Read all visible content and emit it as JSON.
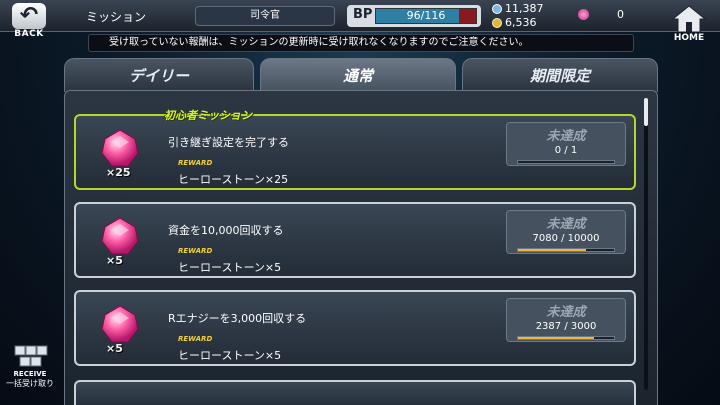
{
  "header": {
    "back_label": "BACK",
    "title": "ミッション",
    "rank": "司令官",
    "bp_label": "BP",
    "bp_value": "96/116",
    "bp_fraction": 0.83,
    "currency_silver": "11,387",
    "currency_gold": "6,536",
    "gems": "0",
    "home_label": "HOME"
  },
  "notice": "受け取っていない報酬は、ミッションの更新時に受け取れなくなりますのでご注意ください。",
  "tabs": [
    {
      "label": "デイリー",
      "active": false
    },
    {
      "label": "通常",
      "active": true
    },
    {
      "label": "期間限定",
      "active": false
    }
  ],
  "beginner_badge": "初心者ミッション",
  "missions": [
    {
      "name": "引き継ぎ設定を完了する",
      "icon_qty": "×25",
      "reward_label": "REWARD",
      "reward": "ヒーローストーン×25",
      "status": "未達成",
      "progress": "0 / 1",
      "progress_fraction": 0.0
    },
    {
      "name": "資金を10,000回収する",
      "icon_qty": "×5",
      "reward_label": "REWARD",
      "reward": "ヒーローストーン×5",
      "status": "未達成",
      "progress": "7080 / 10000",
      "progress_fraction": 0.708
    },
    {
      "name": "Rエナジーを3,000回収する",
      "icon_qty": "×5",
      "reward_label": "REWARD",
      "reward": "ヒーローストーン×5",
      "status": "未達成",
      "progress": "2387 / 3000",
      "progress_fraction": 0.796
    }
  ],
  "receive": {
    "label_en": "RECEIVE",
    "label_jp": "一括受け取り"
  },
  "colors": {
    "beginner_border": "#b6d62c",
    "progress_fill": "#f0b63a",
    "bp_fill": "#2d7fa4"
  },
  "icons": [
    "back-arrow-icon",
    "home-icon",
    "silver-coin-icon",
    "gold-coin-icon",
    "gem-icon",
    "hero-stone-icon",
    "receive-boxes-icon"
  ]
}
